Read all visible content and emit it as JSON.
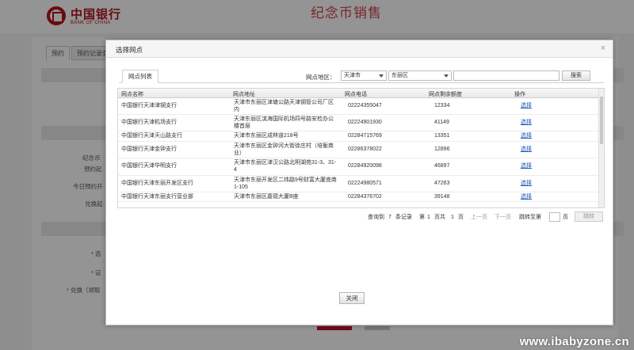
{
  "page": {
    "logo_cn": "中国银行",
    "logo_en": "BANK OF CHINA",
    "site_title": "纪念币销售",
    "bg_tabs": [
      "预约",
      "预约记录查"
    ],
    "bg_labels": [
      "纪念币",
      "预约起",
      "今日预约开",
      "兑换起",
      "* 选",
      "* 证",
      "* 兑换（领取"
    ]
  },
  "dialog": {
    "title": "选择网点",
    "close_icon": "×",
    "tab_label": "网点列表",
    "area_label": "网点地区：",
    "city_select": "天津市",
    "district_select": "东丽区",
    "search_value": "",
    "search_button": "搜索",
    "close_button": "关闭"
  },
  "table": {
    "headers": [
      "网点名称",
      "网点地址",
      "网点电话",
      "网点剩余额度",
      "操作"
    ],
    "rows": [
      {
        "name": "中国银行天津津钢支行",
        "address": "天津市东丽区津塘公路天津钢管公司厂区内",
        "phone": "02224355047",
        "quota": "12334",
        "action": "选择"
      },
      {
        "name": "中国银行天津机场支行",
        "address": "天津东丽区滨海国际机场四号路安检办公楼首层",
        "phone": "02224901930",
        "quota": "41149",
        "action": "选择"
      },
      {
        "name": "中国银行天津天山路支行",
        "address": "天津市东丽区成林道218号",
        "phone": "02284715769",
        "quota": "13351",
        "action": "选择"
      },
      {
        "name": "中国银行天津金钟支行",
        "address": "天津市东丽区金钟河大街徐庄村（培衡商业）",
        "phone": "02286378022",
        "quota": "12896",
        "action": "选择"
      },
      {
        "name": "中国银行天津华明支行",
        "address": "天津市东丽区津汉公路北明湖苑31-3、31-4",
        "phone": "02284920098",
        "quota": "46897",
        "action": "选择"
      },
      {
        "name": "中国银行天津东丽开发区支行",
        "address": "天津市东丽开发区二纬路9号财富大厦底商1-105",
        "phone": "02224980571",
        "quota": "47263",
        "action": "选择"
      },
      {
        "name": "中国银行天津东丽支行营业部",
        "address": "天津市东丽区嘉德大厦B座",
        "phone": "02284376702",
        "quota": "39148",
        "action": "选择"
      }
    ]
  },
  "pager": {
    "total_prefix": "查询到",
    "total_count": "7",
    "total_suffix": "条记录",
    "page_word_1": "第",
    "current_page": "1",
    "page_total_text": "页共",
    "total_pages": "1",
    "page_word_2": "页",
    "prev": "上一页",
    "next": "下一页",
    "jump_to": "跳转至第",
    "jump_suffix": "页",
    "go": "跳转"
  },
  "watermark": "www.ibabyzone.cn"
}
